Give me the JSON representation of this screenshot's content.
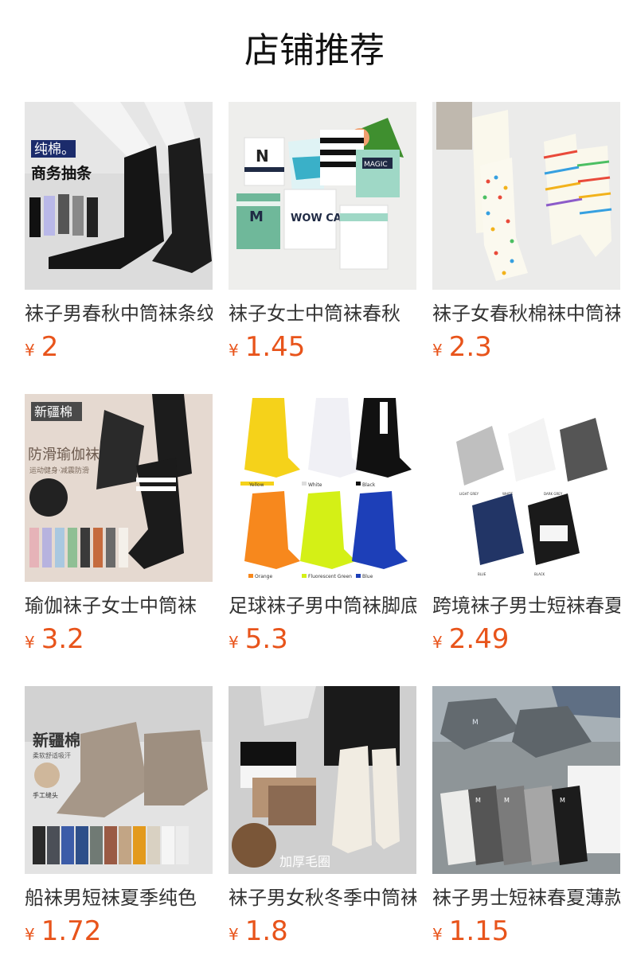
{
  "page": {
    "title": "店铺推荐"
  },
  "currency": "¥",
  "products": [
    {
      "name": "袜子男春秋中筒袜条纹",
      "price": "2",
      "image_text": [
        "纯棉。",
        "商务抽条"
      ]
    },
    {
      "name": "袜子女士中筒袜春秋",
      "price": "1.45",
      "image_text": [
        "N",
        "M",
        "MAGIC",
        "WOW CABRISS"
      ]
    },
    {
      "name": "袜子女春秋棉袜中筒袜",
      "price": "2.3",
      "image_text": []
    },
    {
      "name": "瑜伽袜子女士中筒袜",
      "price": "3.2",
      "image_text": [
        "新疆棉",
        "防滑瑜伽袜",
        "运动健身·减震防滑"
      ]
    },
    {
      "name": "足球袜子男中筒袜脚底",
      "price": "5.3",
      "image_text": [
        "Yellow",
        "White",
        "Black",
        "Orange",
        "Fluorescent Green",
        "Blue"
      ]
    },
    {
      "name": "跨境袜子男士短袜春夏",
      "price": "2.49",
      "image_text": [
        "LIGHT GREY",
        "WHITE",
        "DARK GREY",
        "BLUE",
        "BLACK"
      ]
    },
    {
      "name": "船袜男短袜夏季纯色",
      "price": "1.72",
      "image_text": [
        "新疆棉",
        "柔软舒适吸汗",
        "手工缝头"
      ]
    },
    {
      "name": "袜子男女秋冬季中筒袜",
      "price": "1.8",
      "image_text": [
        "加厚毛圈"
      ]
    },
    {
      "name": "袜子男士短袜春夏薄款",
      "price": "1.15",
      "image_text": [
        "M",
        "M",
        "M",
        "M"
      ]
    }
  ]
}
